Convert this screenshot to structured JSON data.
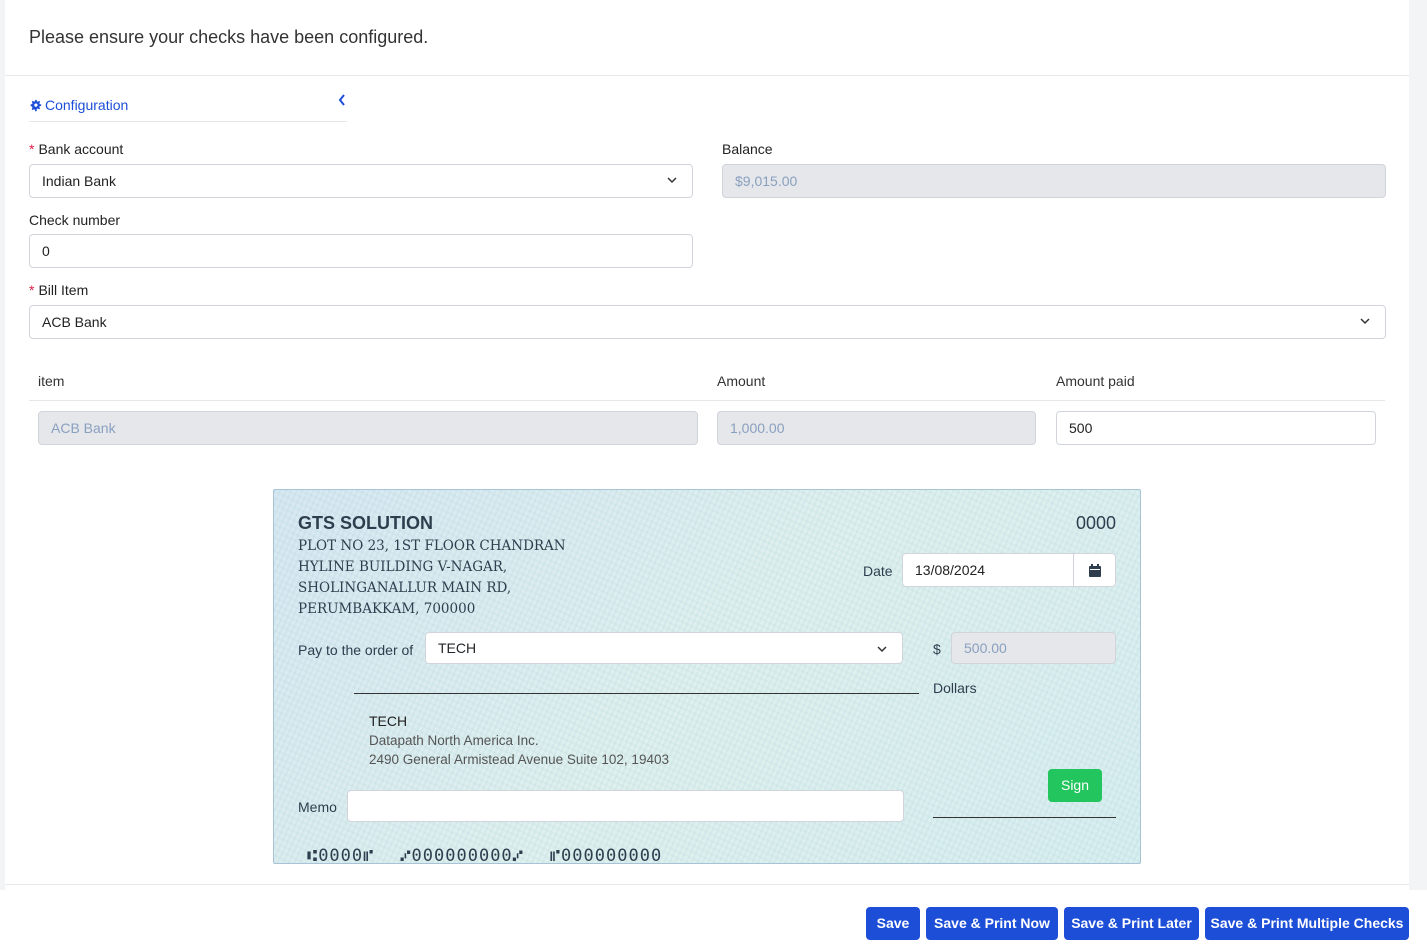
{
  "notice": "Please ensure your checks have been configured.",
  "config_tab": {
    "label": "Configuration",
    "collapse_icon": "chevron-left-icon"
  },
  "bank_account": {
    "label": "Bank account",
    "value": "Indian Bank"
  },
  "balance": {
    "label": "Balance",
    "value": "$9,015.00"
  },
  "check_number": {
    "label": "Check number",
    "value": "0"
  },
  "bill_item": {
    "label": "Bill Item",
    "value": "ACB Bank"
  },
  "items_table": {
    "headers": [
      "item",
      "Amount",
      "Amount paid"
    ],
    "rows": [
      {
        "item": "ACB Bank",
        "amount": "1,000.00",
        "amount_paid": "500"
      }
    ]
  },
  "check": {
    "company": "GTS SOLUTION",
    "address": [
      "PLOT NO 23, 1ST FLOOR CHANDRAN",
      "HYLINE BUILDING V-NAGAR,",
      "SHOLINGANALLUR MAIN RD,",
      "PERUMBAKKAM, 700000"
    ],
    "check_no": "0000",
    "date_label": "Date",
    "date_value": "13/08/2024",
    "pay_label": "Pay to the order of",
    "payee": "TECH",
    "dollar_sign": "$",
    "amount": "500.00",
    "dollars_label": "Dollars",
    "payee_name": "TECH",
    "payee_address1": "Datapath North America Inc.",
    "payee_address2": "2490 General Armistead Avenue Suite 102, 19403",
    "sign_label": "Sign",
    "memo_label": "Memo",
    "memo_value": "",
    "micr_check": "⑆0000⑈",
    "micr_routing": "⑇000000000⑇",
    "micr_account": "⑈000000000"
  },
  "buttons": {
    "save": "Save",
    "save_print_now": "Save & Print Now",
    "save_print_later": "Save & Print Later",
    "save_print_multiple": "Save & Print Multiple Checks"
  },
  "colors": {
    "primary": "#1d4ed8",
    "success": "#22c55e",
    "required": "#e11d48"
  }
}
